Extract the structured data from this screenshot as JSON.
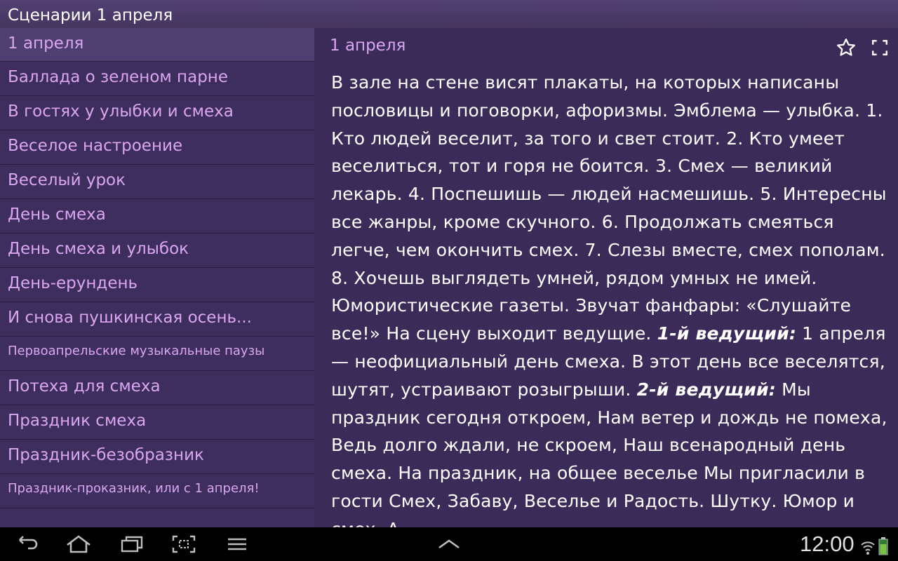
{
  "app": {
    "title": "Сценарии 1 апреля"
  },
  "sidebar": {
    "items": [
      {
        "label": "1 апреля",
        "selected": true
      },
      {
        "label": "Баллада о зеленом парне"
      },
      {
        "label": "В гостях у улыбки и смеха"
      },
      {
        "label": "Веселое настроение"
      },
      {
        "label": "Веселый урок"
      },
      {
        "label": "День смеха"
      },
      {
        "label": "День смеха и улыбок"
      },
      {
        "label": "День-ерундень"
      },
      {
        "label": "И снова пушкинская осень..."
      },
      {
        "label": "Первоапрельские музыкальные паузы"
      },
      {
        "label": "Потеха для смеха"
      },
      {
        "label": "Праздник смеха"
      },
      {
        "label": "Праздник-безобразник"
      },
      {
        "label": "Праздник-проказник, или с 1 апреля!"
      }
    ]
  },
  "content": {
    "header": "1 апреля",
    "p1": "В зале на стене висят плакаты, на которых написаны пословицы и поговорки, афоризмы. Эмблема — улыбка. 1. Кто людей веселит, за того и свет стоит. 2. Кто умеет веселиться, тот и горя не боится. 3. Смех — великий лекарь. 4. Поспешишь — людей насмешишь. 5. Интересны все жанры, кроме скучного. 6. Продолжать смеяться легче, чем окончить смех. 7. Слезы вместе, смех пополам. 8. Хочешь выглядеть умней, рядом умных не имей. Юмористические газеты. Звучат фанфары: «Слушайте все!» На сцену выходит ведущие. ",
    "speaker1": "1-й ведущий:",
    "p2": " 1 апреля — неофициальный день смеха. В этот день все веселятся, шутят, устраивают розыгрыши. ",
    "speaker2": "2-й ведущий:",
    "p3": " Мы праздник сегодня откроем, Нам ветер и дождь не помеха, Ведь долго ждали, не скроем, Наш всенародный день смеха. На праздник, на общее веселье Мы пригласили в гости Смех, Забаву, Веселье и Радость. Шутку. Юмор и смех. А"
  },
  "status_bar": {
    "time": "12:00"
  },
  "colors": {
    "background": "#3b2b58",
    "accent_text": "#d9a6ef",
    "nav_bar": "#000000"
  }
}
